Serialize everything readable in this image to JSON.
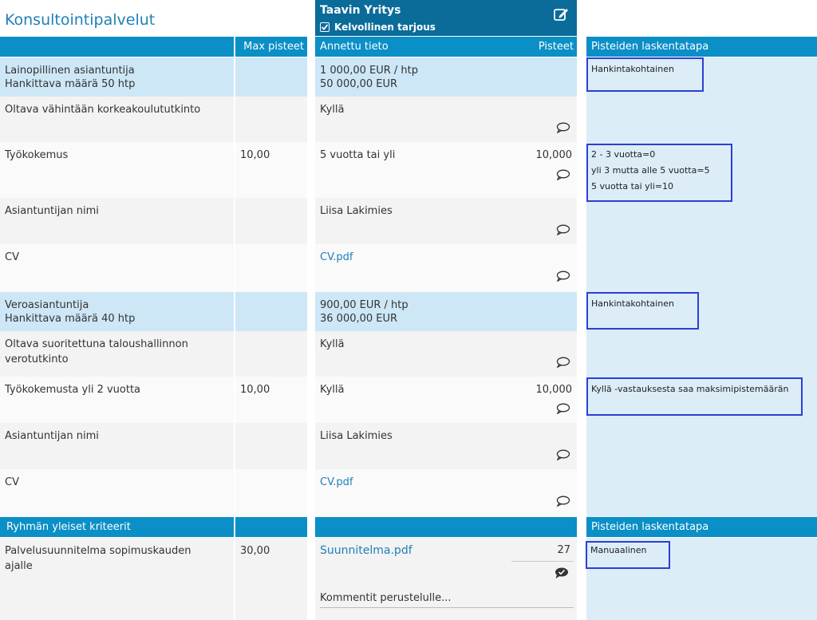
{
  "title": "Konsultointipalvelut",
  "supplier": {
    "name": "Taavin Yritys",
    "status": "Kelvollinen tarjous",
    "edit_icon": "edit-icon",
    "check_icon": "checkbox-checked-icon"
  },
  "headers": {
    "max_points": "Max pisteet",
    "given_info": "Annettu tieto",
    "points": "Pisteet",
    "calc_method": "Pisteiden laskentatapa"
  },
  "rows": [
    {
      "label1": "Lainopillinen asiantuntija",
      "label2": "Hankittava määrä 50 htp",
      "max": "",
      "info1": "1 000,00 EUR / htp",
      "info2": "50 000,00 EUR",
      "points": "",
      "method": "Hankintakohtainen"
    },
    {
      "label1": "Oltava vähintään korkeakoulututkinto",
      "max": "",
      "info1": "Kyllä",
      "points": ""
    },
    {
      "label1": "Työkokemus",
      "max": "10,00",
      "info1": "5 vuotta tai yli",
      "points": "10,000",
      "method_lines": [
        "2 - 3 vuotta=0",
        "yli 3 mutta alle 5 vuotta=5",
        "5 vuotta tai yli=10"
      ]
    },
    {
      "label1": "Asiantuntijan nimi",
      "info1": "Liisa Lakimies"
    },
    {
      "label1": "CV",
      "info1": "CV.pdf"
    },
    {
      "label1": "Veroasiantuntija",
      "label2": "Hankittava määrä 40 htp",
      "info1": "900,00 EUR / htp",
      "info2": "36 000,00 EUR",
      "method": "Hankintakohtainen"
    },
    {
      "label1": "Oltava suoritettuna taloushallinnon",
      "label2": "verotutkinto",
      "info1": "Kyllä"
    },
    {
      "label1": "Työkokemusta yli 2 vuotta",
      "max": "10,00",
      "info1": "Kyllä",
      "points": "10,000",
      "method": "Kyllä -vastauksesta saa maksimipistemäärän"
    },
    {
      "label1": "Asiantuntijan nimi",
      "info1": "Liisa Lakimies"
    },
    {
      "label1": "CV",
      "info1": "CV.pdf"
    }
  ],
  "group": {
    "header": "Ryhmän yleiset kriteerit",
    "calc_method": "Pisteiden laskentatapa",
    "label1": "Palvelusuunnitelma sopimuskauden",
    "label2": "ajalle",
    "max": "30,00",
    "info1": "Suunnitelma.pdf",
    "points": "27",
    "method": "Manuaalinen",
    "comment_placeholder": "Kommentit perustelulle..."
  }
}
